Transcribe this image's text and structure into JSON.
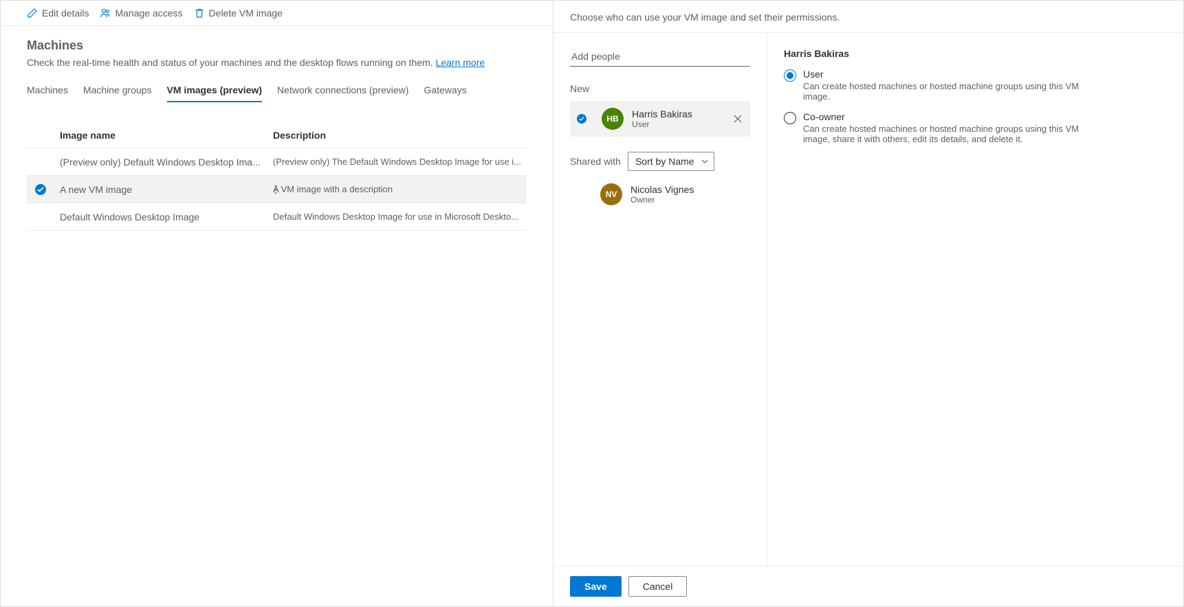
{
  "toolbar": {
    "edit": "Edit details",
    "manage": "Manage access",
    "delete": "Delete VM image"
  },
  "page": {
    "title": "Machines",
    "subtitle_pre": "Check the real-time health and status of your machines and the desktop flows running on them. ",
    "learn_more": "Learn more"
  },
  "tabs": {
    "machines": "Machines",
    "groups": "Machine groups",
    "vmimages": "VM images (preview)",
    "network": "Network connections (preview)",
    "gateways": "Gateways"
  },
  "table": {
    "headers": {
      "name": "Image name",
      "desc": "Description"
    },
    "rows": [
      {
        "name": "(Preview only) Default Windows Desktop Ima...",
        "desc": "(Preview only) The Default Windows Desktop Image for use i...",
        "selected": false
      },
      {
        "name": "A new VM image",
        "desc": "A VM image with a description",
        "selected": true
      },
      {
        "name": "Default Windows Desktop Image",
        "desc": "Default Windows Desktop Image for use in Microsoft Deskto...",
        "selected": false
      }
    ]
  },
  "panel": {
    "header": "Choose who can use your VM image and set their permissions.",
    "add_people_placeholder": "Add people",
    "new_label": "New",
    "new_person": {
      "initials": "HB",
      "name": "Harris Bakiras",
      "role": "User"
    },
    "shared_with_label": "Shared with",
    "sort_label": "Sort by Name",
    "owner": {
      "initials": "NV",
      "name": "Nicolas Vignes",
      "role": "Owner"
    },
    "detail_heading": "Harris Bakiras",
    "permissions": [
      {
        "label": "User",
        "desc": "Can create hosted machines or hosted machine groups using this VM image.",
        "checked": true
      },
      {
        "label": "Co-owner",
        "desc": "Can create hosted machines or hosted machine groups using this VM image, share it with others, edit its details, and delete it.",
        "checked": false
      }
    ],
    "save": "Save",
    "cancel": "Cancel"
  }
}
